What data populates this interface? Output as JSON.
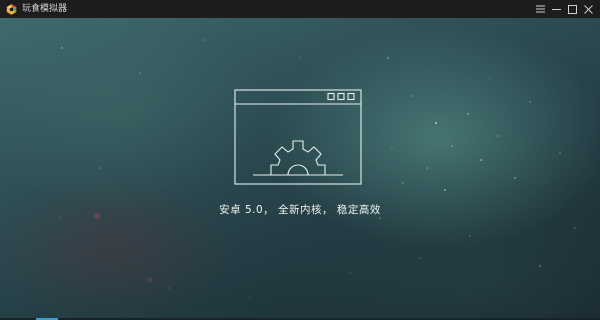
{
  "window": {
    "title": "玩食模拟器",
    "logo_icon": "hexagon-logo-icon",
    "controls": [
      {
        "name": "menu",
        "icon": "menu-icon"
      },
      {
        "name": "minimize",
        "icon": "minimize-icon"
      },
      {
        "name": "maximize",
        "icon": "maximize-icon"
      },
      {
        "name": "close",
        "icon": "close-icon"
      }
    ]
  },
  "splash": {
    "illustration_icon": "window-gear-icon",
    "message": "安卓 5.0， 全新内核， 稳定高效"
  },
  "colors": {
    "titlebar": "#1d1d1f",
    "background_teal": "#3f6a6c",
    "background_dark": "#1a2a30",
    "line_art": "#e6efee",
    "accent": "#3aa0c9"
  }
}
